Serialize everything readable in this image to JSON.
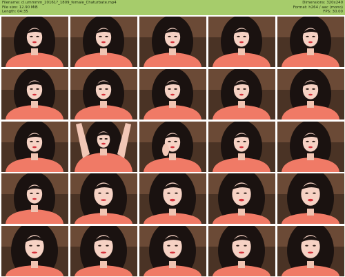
{
  "header": {
    "left_lines": [
      "Filename: cl.ummmm_20161?_1809_female_Chaturbate.mp4",
      "File size: 12.90 MiB",
      "Length: 04:35"
    ],
    "right_lines": [
      "Dimensions: 320x240",
      "Format: h264 / aac (mono)",
      "FPS: 30.00"
    ],
    "background_color": "#a6cc6b"
  },
  "grid": {
    "rows": 5,
    "columns": 5,
    "thumbnails": [
      {
        "pose": "front",
        "top": "pink"
      },
      {
        "pose": "front",
        "top": "pink"
      },
      {
        "pose": "front",
        "top": "pink"
      },
      {
        "pose": "front",
        "top": "pink"
      },
      {
        "pose": "front",
        "top": "pink"
      },
      {
        "pose": "front",
        "top": "pink"
      },
      {
        "pose": "front",
        "top": "pink"
      },
      {
        "pose": "front",
        "top": "pink"
      },
      {
        "pose": "front",
        "top": "pink"
      },
      {
        "pose": "front",
        "top": "pink"
      },
      {
        "pose": "front",
        "top": "pink"
      },
      {
        "pose": "arms-up",
        "top": "pink"
      },
      {
        "pose": "hand-face",
        "top": "pink"
      },
      {
        "pose": "front",
        "top": "pink"
      },
      {
        "pose": "front",
        "top": "pink"
      },
      {
        "pose": "front",
        "top": "pink"
      },
      {
        "pose": "close",
        "top": "pink"
      },
      {
        "pose": "smile",
        "top": "pink"
      },
      {
        "pose": "smile",
        "top": "pink"
      },
      {
        "pose": "smile",
        "top": "pink"
      },
      {
        "pose": "close",
        "top": "pink"
      },
      {
        "pose": "close",
        "top": "pink"
      },
      {
        "pose": "close",
        "top": "pink"
      },
      {
        "pose": "close",
        "top": "pink"
      },
      {
        "pose": "close",
        "top": "pink"
      }
    ]
  }
}
